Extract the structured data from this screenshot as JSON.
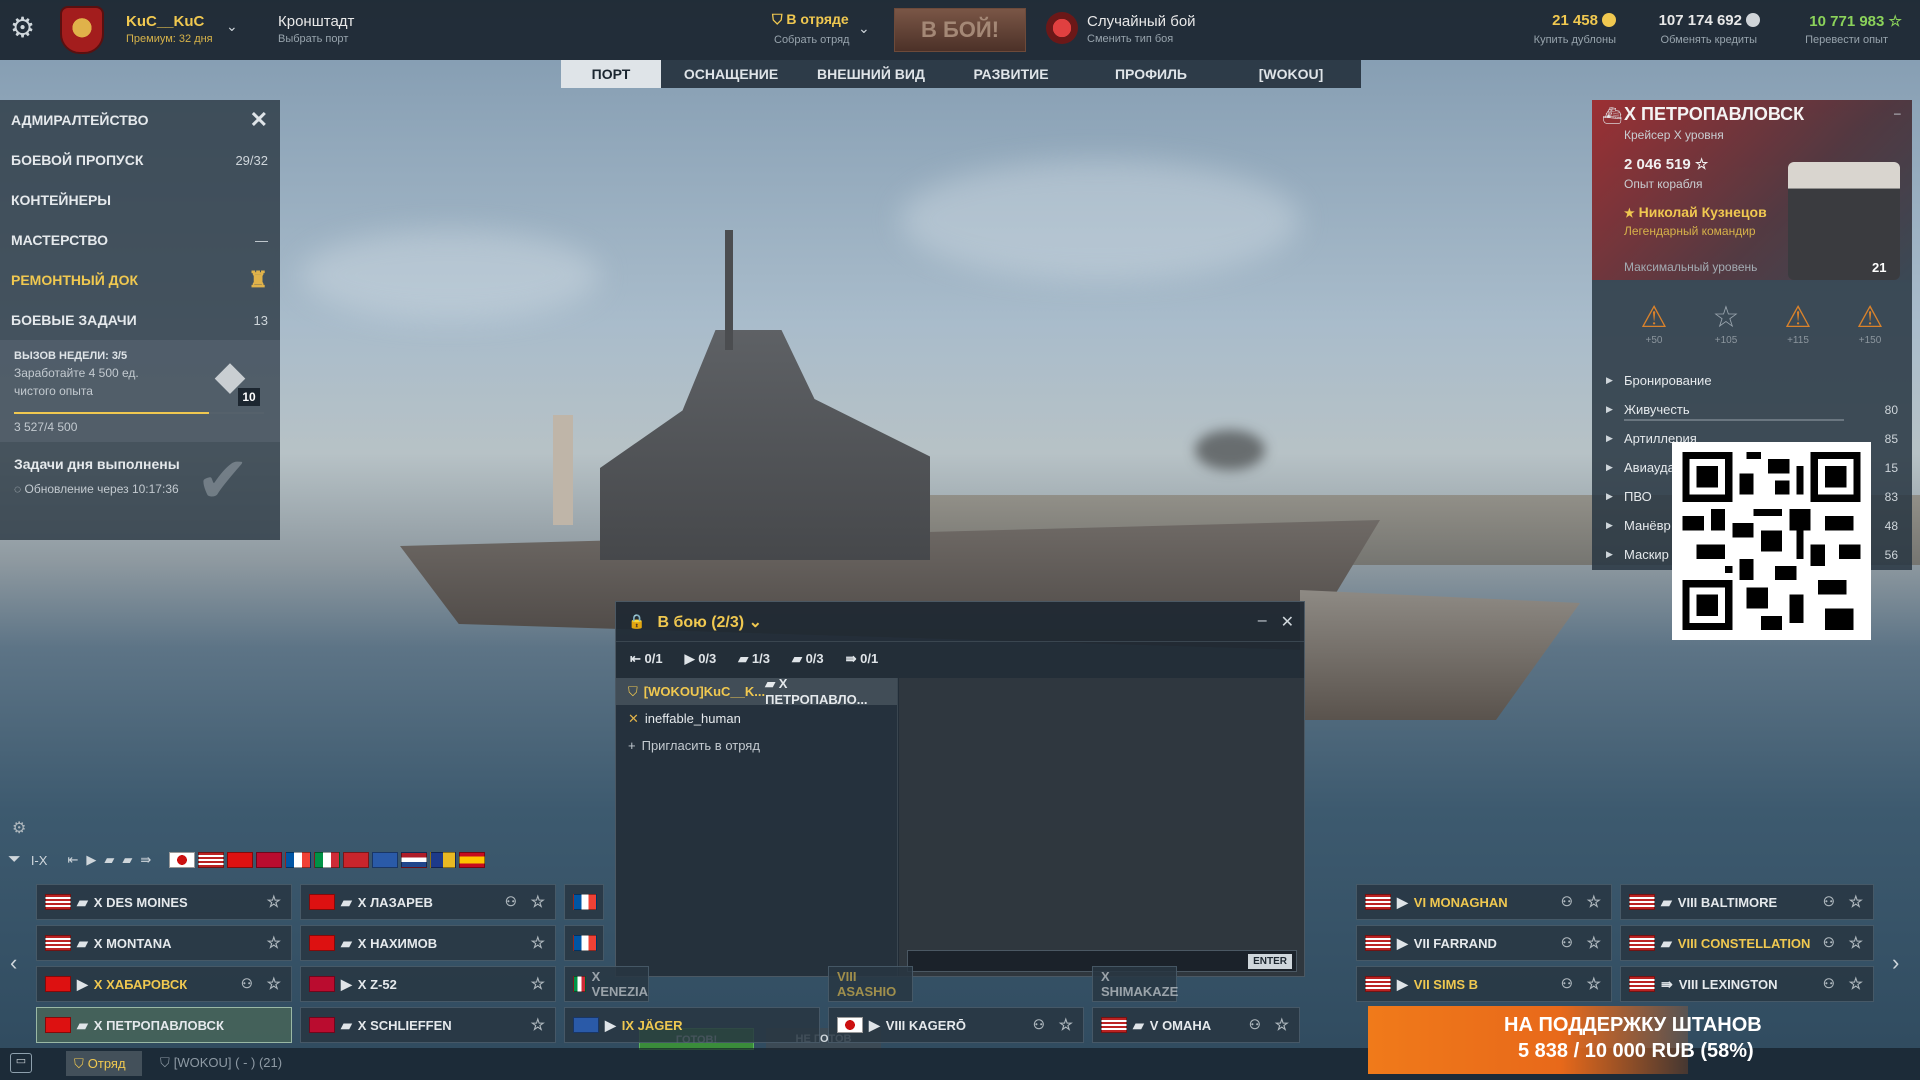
{
  "topbar": {
    "player_name": "KuC__KuC",
    "premium": "Премиум: 32 дня",
    "port_name": "Кронштадт",
    "port_sub": "Выбрать порт",
    "squad_status": "В отряде",
    "squad_sub": "Собрать отряд",
    "battle_button": "В БОЙ!",
    "mode_name": "Случайный бой",
    "mode_sub": "Сменить тип боя",
    "doubloons": "21 458",
    "doubloons_sub": "Купить дублоны",
    "credits": "107 174 692",
    "credits_sub": "Обменять кредиты",
    "free_xp": "10 771 983",
    "free_xp_sub": "Перевести опыт"
  },
  "tabs": [
    "ПОРТ",
    "ОСНАЩЕНИЕ",
    "ВНЕШНИЙ ВИД",
    "РАЗВИТИЕ",
    "ПРОФИЛЬ",
    "[WOKOU]"
  ],
  "sidebar": {
    "items": [
      {
        "label": "АДМИРАЛТЕЙСТВО",
        "count": ""
      },
      {
        "label": "БОЕВОЙ ПРОПУСК",
        "count": "29/32"
      },
      {
        "label": "КОНТЕЙНЕРЫ",
        "count": ""
      },
      {
        "label": "МАСТЕРСТВО",
        "count": "—"
      },
      {
        "label": "РЕМОНТНЫЙ ДОК",
        "count": ""
      },
      {
        "label": "БОЕВЫЕ ЗАДАЧИ",
        "count": "13"
      }
    ],
    "challenge": {
      "title": "ВЫЗОВ НЕДЕЛИ: 3/5",
      "desc1": "Заработайте 4 500 ед.",
      "desc2": "чистого опыта",
      "level": "10",
      "progress_text": "3 527/4 500",
      "progress": 0.78
    },
    "daily": {
      "title": "Задачи дня выполнены",
      "refresh": "Обновление через 10:17:36"
    }
  },
  "ship_panel": {
    "title": "X ПЕТРОПАВЛОВСК",
    "class": "Крейсер X уровня",
    "xp": "2 046 519",
    "xp_sub": "Опыт корабля",
    "commander": "Николай Кузнецов",
    "commander_sub": "Легендарный командир",
    "commander_level": "Максимальный уровень",
    "portrait_level": "21",
    "skills": [
      "+50",
      "+105",
      "+115",
      "+150"
    ],
    "stats": [
      {
        "label": "Бронирование",
        "value": ""
      },
      {
        "label": "Живучесть",
        "value": "80"
      },
      {
        "label": "Артиллерия",
        "value": "85"
      },
      {
        "label": "Авиаудар",
        "value": "15"
      },
      {
        "label": "ПВО",
        "value": "83"
      },
      {
        "label": "Манёвр",
        "value": "48"
      },
      {
        "label": "Маскир",
        "value": "56"
      }
    ]
  },
  "dialog": {
    "title": "В бою (2/3)",
    "counts": [
      "0/1",
      "0/3",
      "1/3",
      "0/3",
      "0/1"
    ],
    "members": [
      {
        "name": "[WOKOU]KuC__K...",
        "ship": "X ПЕТРОПАВЛО..."
      },
      {
        "name": "ineffable_human",
        "ship": ""
      }
    ],
    "invite": "Пригласить в отряд",
    "ready": "ГОТОВ!",
    "not_ready": "НЕ ГОТОВ",
    "enter": "ENTER"
  },
  "filter": {
    "tier": "I-X"
  },
  "carousel": [
    {
      "name": "X DES MOINES"
    },
    {
      "name": "X MONTANA"
    },
    {
      "name": "X ХАБАРОВСК"
    },
    {
      "name": "X ПЕТРОПАВЛОВСК"
    },
    {
      "name": "X ЛАЗАРЕВ"
    },
    {
      "name": "X НАХИМОВ"
    },
    {
      "name": "X Z-52"
    },
    {
      "name": "X SCHLIEFFEN"
    },
    {
      "name": "X VENEZIA"
    },
    {
      "name": "IX JÄGER"
    },
    {
      "name": "VIII ASASHIO"
    },
    {
      "name": "VIII KAGERŌ"
    },
    {
      "name": "X SHIMAKAZE"
    },
    {
      "name": "V OMAHA"
    },
    {
      "name": "VI MONAGHAN"
    },
    {
      "name": "VII FARRAND"
    },
    {
      "name": "VII SIMS B"
    },
    {
      "name": "VIII BALTIMORE"
    },
    {
      "name": "VIII CONSTELLATION"
    },
    {
      "name": "VIII LEXINGTON"
    }
  ],
  "bottom": {
    "squad_tab": "Отряд",
    "clan_tab": "[WOKOU] ( - )  (21)",
    "donation_line1": "НА ПОДДЕРЖКУ ШТАНОВ",
    "donation_line2": "5 838 / 10 000 RUB (58%)"
  }
}
